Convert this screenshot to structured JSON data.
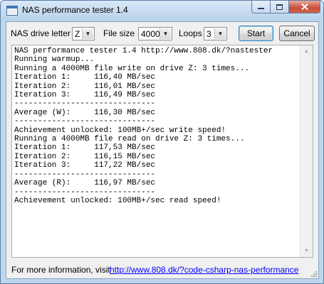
{
  "window": {
    "title": "NAS performance tester 1.4"
  },
  "caption_buttons": {
    "minimize_icon": "minimize-icon",
    "maximize_icon": "maximize-icon",
    "close_icon": "close-icon"
  },
  "toolbar": {
    "drive_label": "NAS drive letter",
    "drive_value": "Z",
    "filesize_label": "File size",
    "filesize_value": "4000",
    "loops_label": "Loops",
    "loops_value": "3",
    "start_label": "Start",
    "cancel_label": "Cancel"
  },
  "log": {
    "lines": "NAS performance tester 1.4 http://www.808.dk/?nastester\nRunning warmup...\nRunning a 4000MB file write on drive Z: 3 times...\nIteration 1:     116,40 MB/sec\nIteration 2:     116,01 MB/sec\nIteration 3:     116,49 MB/sec\n------------------------------\nAverage (W):     116,30 MB/sec\n------------------------------\nAchievement unlocked: 100MB+/sec write speed!\nRunning a 4000MB file read on drive Z: 3 times...\nIteration 1:     117,53 MB/sec\nIteration 2:     116,15 MB/sec\nIteration 3:     117,22 MB/sec\n------------------------------\nAverage (R):     116,97 MB/sec\n------------------------------\nAchievement unlocked: 100MB+/sec read speed!"
  },
  "footer": {
    "info_label": "For more information, visit",
    "link_text": "http://www.808.dk/?code-csharp-nas-performance"
  },
  "colors": {
    "link": "#0000ff",
    "title_bar": "#bfd6ec",
    "close_button": "#c8503a"
  }
}
